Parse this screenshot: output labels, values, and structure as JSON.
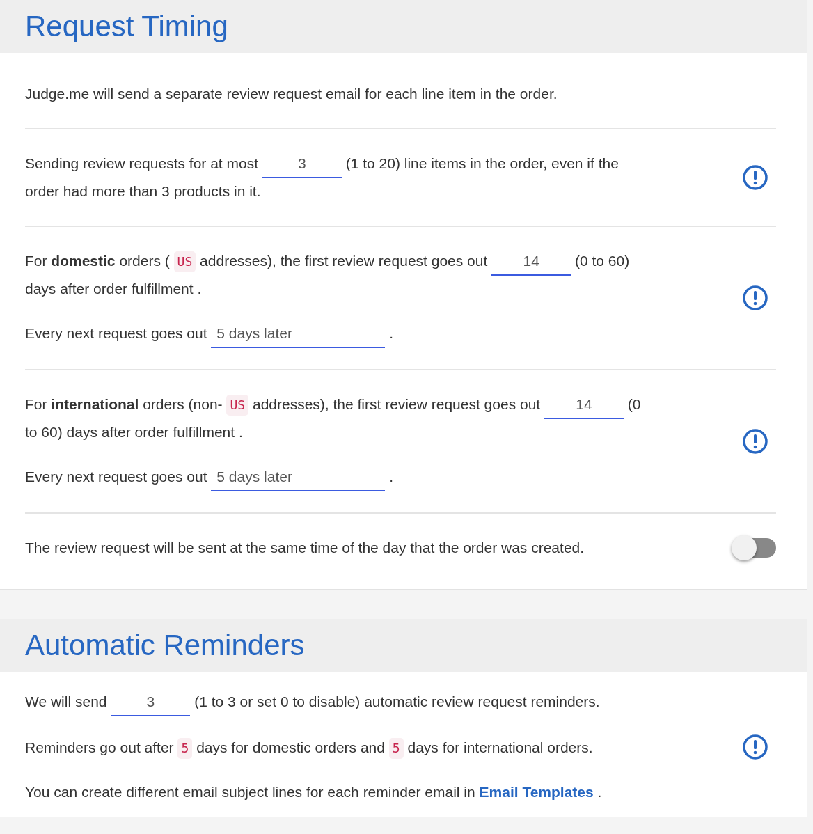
{
  "sections": [
    {
      "title": "Request Timing",
      "blocks": [
        {
          "info": false,
          "paragraphs": [
            [
              {
                "kind": "text",
                "text": "Judge.me will send a separate review request email for each line item in the order."
              }
            ]
          ]
        },
        {
          "info": true,
          "paragraphs": [
            [
              {
                "kind": "text",
                "text": "Sending review requests for at most"
              },
              {
                "kind": "input",
                "value": "3"
              },
              {
                "kind": "text",
                "text": "(1 to 20) line items in the order, even if the"
              },
              {
                "kind": "text",
                "text": "order had more than 3 products in it."
              }
            ]
          ]
        },
        {
          "info": true,
          "paragraphs": [
            [
              {
                "kind": "text",
                "text": "For **domestic** orders ("
              },
              {
                "kind": "code",
                "text": "US"
              },
              {
                "kind": "text",
                "text": "addresses), the first review request goes out"
              },
              {
                "kind": "input",
                "value": "14"
              },
              {
                "kind": "text",
                "text": "(0 to 60)"
              },
              {
                "kind": "text",
                "text": "days after order fulfillment ."
              }
            ],
            [
              {
                "kind": "text",
                "text": "Every next request goes out"
              },
              {
                "kind": "select",
                "value": "5 days later"
              },
              {
                "kind": "text",
                "text": "."
              }
            ]
          ]
        },
        {
          "info": true,
          "paragraphs": [
            [
              {
                "kind": "text",
                "text": "For **international** orders (non-"
              },
              {
                "kind": "code",
                "text": "US"
              },
              {
                "kind": "text",
                "text": "addresses), the first review request goes out"
              },
              {
                "kind": "input",
                "value": "14"
              },
              {
                "kind": "text",
                "text": "(0"
              },
              {
                "kind": "text",
                "text": "to 60) days after order fulfillment ."
              }
            ],
            [
              {
                "kind": "text",
                "text": "Every next request goes out"
              },
              {
                "kind": "select",
                "value": "5 days later"
              },
              {
                "kind": "text",
                "text": "."
              }
            ]
          ]
        },
        {
          "info": false,
          "toggle": {
            "on": false
          },
          "paragraphs": [
            [
              {
                "kind": "text",
                "text": "The review request will be sent at the same time of the day that the order was created."
              }
            ]
          ]
        }
      ]
    },
    {
      "title": "Automatic Reminders",
      "blocks": [
        {
          "info": true,
          "paragraphs": [
            [
              {
                "kind": "text",
                "text": "We will send"
              },
              {
                "kind": "input",
                "value": "3"
              },
              {
                "kind": "text",
                "text": "(1 to 3 or set 0 to disable) automatic review request reminders."
              }
            ],
            [
              {
                "kind": "text",
                "text": "Reminders go out after"
              },
              {
                "kind": "code",
                "text": "5"
              },
              {
                "kind": "text",
                "text": "days for domestic orders and"
              },
              {
                "kind": "code",
                "text": "5"
              },
              {
                "kind": "text",
                "text": "days for international orders."
              }
            ],
            [
              {
                "kind": "text",
                "text": "You can create different email subject lines for each reminder email in"
              },
              {
                "kind": "link",
                "text": "Email Templates"
              },
              {
                "kind": "text",
                "text": "."
              }
            ]
          ]
        }
      ]
    }
  ]
}
